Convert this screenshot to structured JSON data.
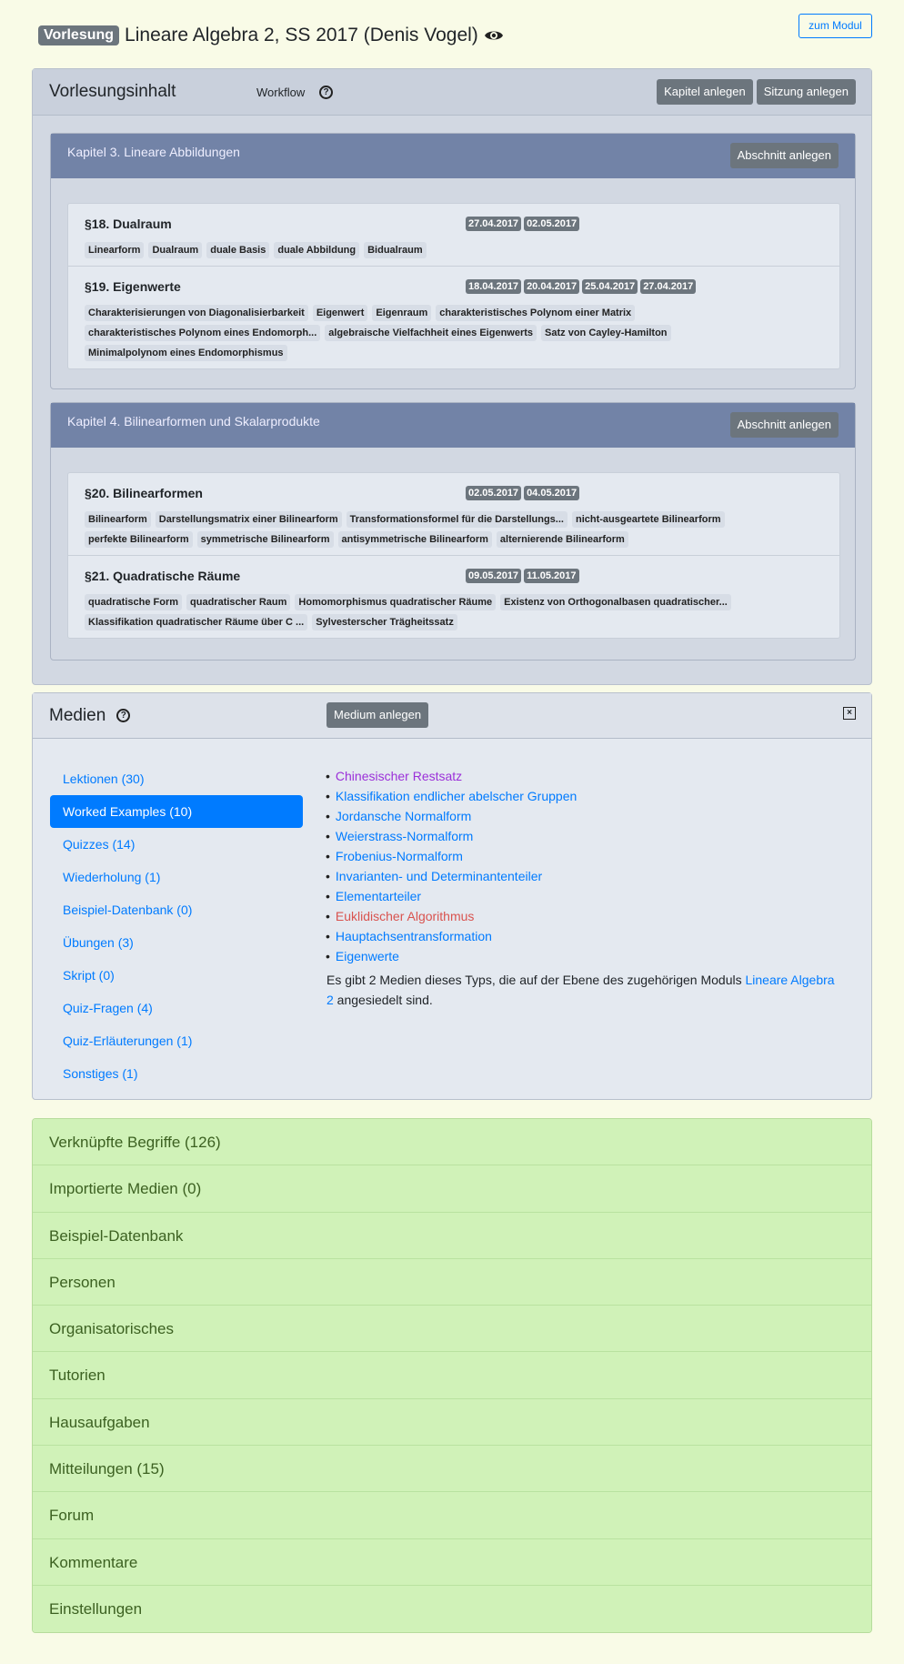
{
  "header": {
    "badge": "Vorlesung",
    "title": "Lineare Algebra 2, SS 2017 (Denis Vogel)",
    "zum_modul": "zum Modul"
  },
  "inhalt": {
    "title": "Vorlesungsinhalt",
    "workflow": "Workflow",
    "kapitel_btn": "Kapitel anlegen",
    "sitzung_btn": "Sitzung anlegen"
  },
  "chapters": [
    {
      "title": "Kapitel 3. Lineare Abbildungen",
      "btn": "Abschnitt anlegen",
      "sections": [
        {
          "title": "§18. Dualraum",
          "dates": [
            "27.04.2017",
            "02.05.2017"
          ],
          "tags": [
            "Linearform",
            "Dualraum",
            "duale Basis",
            "duale Abbildung",
            "Bidualraum"
          ]
        },
        {
          "title": "§19. Eigenwerte",
          "dates": [
            "18.04.2017",
            "20.04.2017",
            "25.04.2017",
            "27.04.2017"
          ],
          "tags": [
            "Charakterisierungen von Diagonalisierbarkeit",
            "Eigenwert",
            "Eigenraum",
            "charakteristisches Polynom einer Matrix",
            "charakteristisches Polynom eines Endomorph...",
            "algebraische Vielfachheit eines Eigenwerts",
            "Satz von Cayley-Hamilton",
            "Minimalpolynom eines Endomorphismus"
          ]
        }
      ]
    },
    {
      "title": "Kapitel 4. Bilinearformen und Skalarprodukte",
      "btn": "Abschnitt anlegen",
      "sections": [
        {
          "title": "§20. Bilinearformen",
          "dates": [
            "02.05.2017",
            "04.05.2017"
          ],
          "tags": [
            "Bilinearform",
            "Darstellungsmatrix einer Bilinearform",
            "Transformationsformel für die Darstellungs...",
            "nicht-ausgeartete Bilinearform",
            "perfekte Bilinearform",
            "symmetrische Bilinearform",
            "antisymmetrische Bilinearform",
            "alternierende Bilinearform"
          ]
        },
        {
          "title": "§21. Quadratische Räume",
          "dates": [
            "09.05.2017",
            "11.05.2017"
          ],
          "tags": [
            "quadratische Form",
            "quadratischer Raum",
            "Homomorphismus quadratischer Räume",
            "Existenz von Orthogonalbasen quadratischer...",
            "Klassifikation quadratischer Räume über C ...",
            "Sylvesterscher Trägheitssatz"
          ]
        }
      ]
    }
  ],
  "medien": {
    "title": "Medien",
    "btn": "Medium anlegen",
    "nav": [
      "Lektionen (30)",
      "Worked Examples (10)",
      "Quizzes (14)",
      "Wiederholung (1)",
      "Beispiel-Datenbank (0)",
      "Übungen (3)",
      "Skript (0)",
      "Quiz-Fragen (4)",
      "Quiz-Erläuterungen (1)",
      "Sonstiges (1)"
    ],
    "items": [
      {
        "t": "Chinesischer Restsatz",
        "c": "#9b30d9"
      },
      {
        "t": "Klassifikation endlicher abelscher Gruppen",
        "c": "#007bff"
      },
      {
        "t": "Jordansche Normalform",
        "c": "#007bff"
      },
      {
        "t": "Weierstrass-Normalform",
        "c": "#007bff"
      },
      {
        "t": "Frobenius-Normalform",
        "c": "#007bff"
      },
      {
        "t": "Invarianten- und Determinantenteiler",
        "c": "#007bff"
      },
      {
        "t": "Elementarteiler",
        "c": "#007bff"
      },
      {
        "t": "Euklidischer Algorithmus",
        "c": "#d9534f"
      },
      {
        "t": "Hauptachsentransformation",
        "c": "#007bff"
      },
      {
        "t": "Eigenwerte",
        "c": "#007bff"
      }
    ],
    "note_pre": "Es gibt 2 Medien dieses Typs, die auf der Ebene des zugehörigen Moduls ",
    "note_link": "Lineare Algebra 2",
    "note_post": " angesiedelt sind."
  },
  "accordion": [
    "Verknüpfte Begriffe (126)",
    "Importierte Medien (0)",
    "Beispiel-Datenbank",
    "Personen",
    "Organisatorisches",
    "Tutorien",
    "Hausaufgaben",
    "Mitteilungen (15)",
    "Forum",
    "Kommentare",
    "Einstellungen"
  ]
}
